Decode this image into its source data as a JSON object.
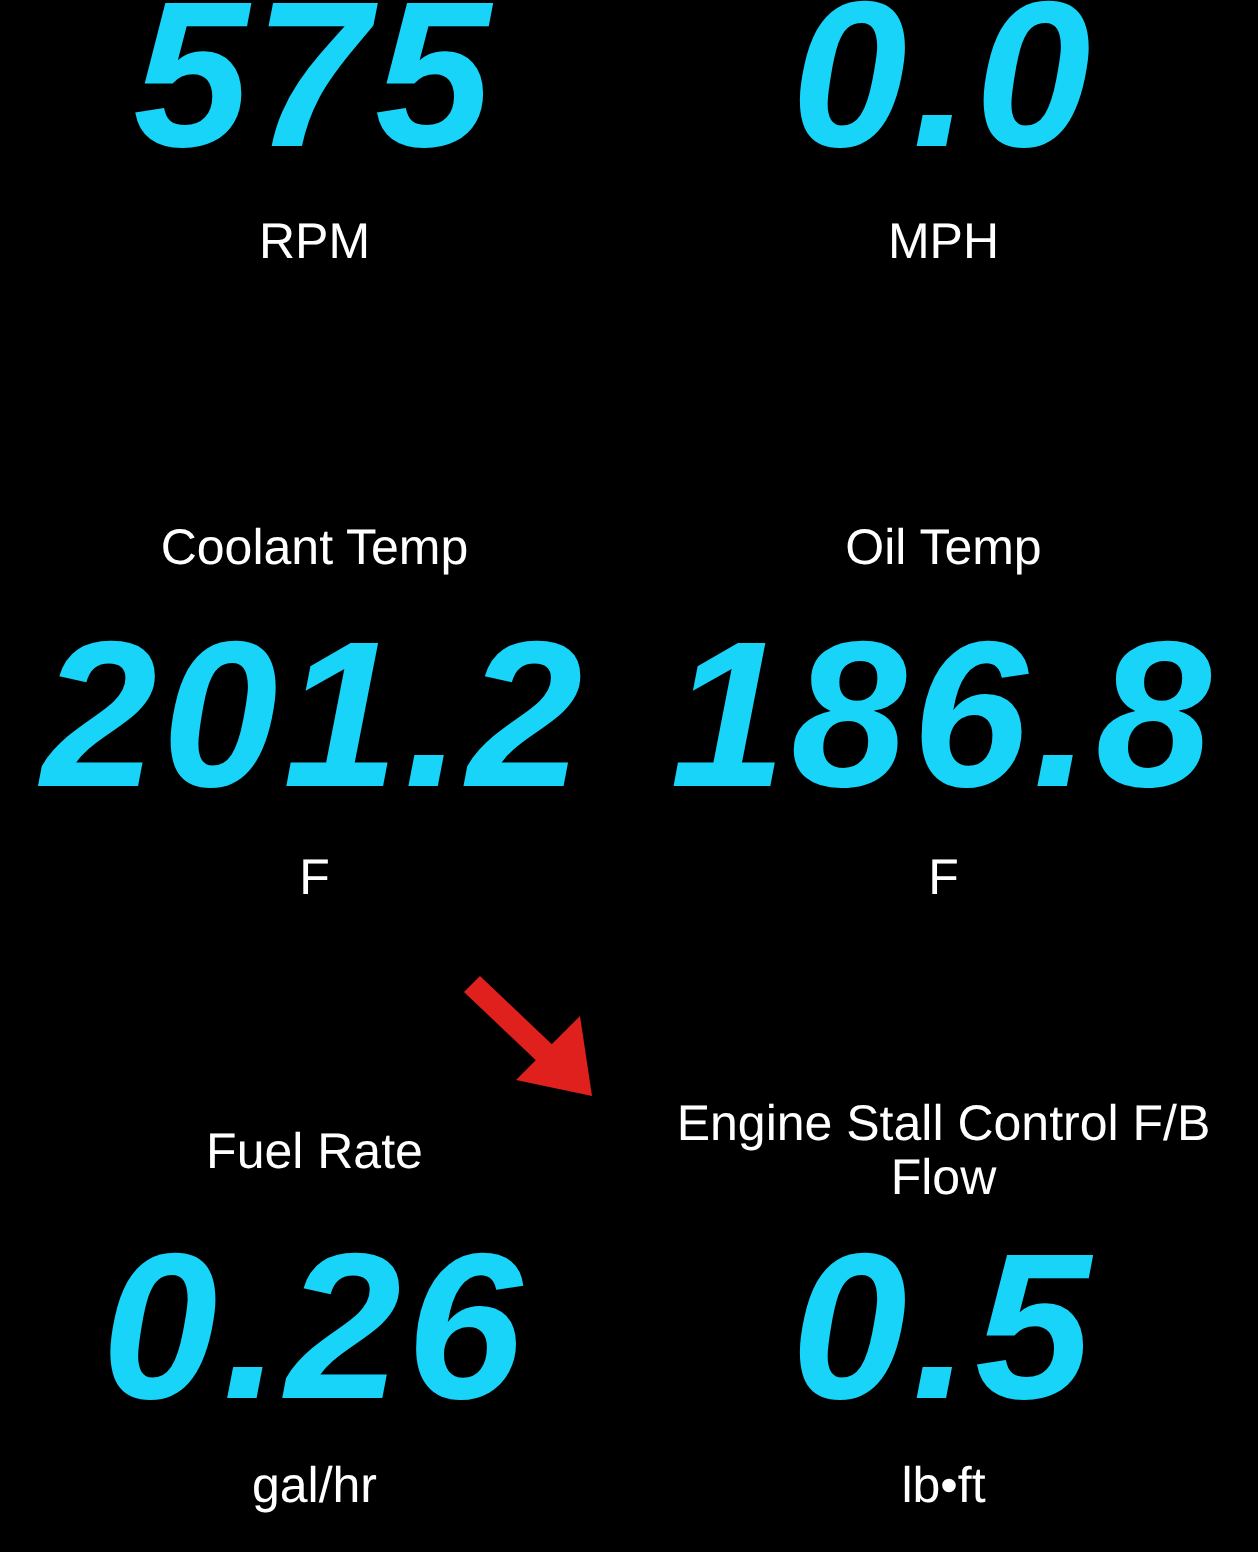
{
  "gauges": [
    {
      "kind": "value-top",
      "value": "575",
      "label": "RPM"
    },
    {
      "kind": "value-top",
      "value": "0.0",
      "label": "MPH"
    },
    {
      "kind": "label-top",
      "label": "Coolant Temp",
      "value": "201.2",
      "unit": "F"
    },
    {
      "kind": "label-top",
      "label": "Oil Temp",
      "value": "186.8",
      "unit": "F"
    },
    {
      "kind": "label-top",
      "label": "Fuel Rate",
      "value": "0.26",
      "unit": "gal/hr"
    },
    {
      "kind": "label-top",
      "label": "Engine Stall Control F/B Flow",
      "value": "0.5",
      "unit": "lb•ft"
    }
  ]
}
